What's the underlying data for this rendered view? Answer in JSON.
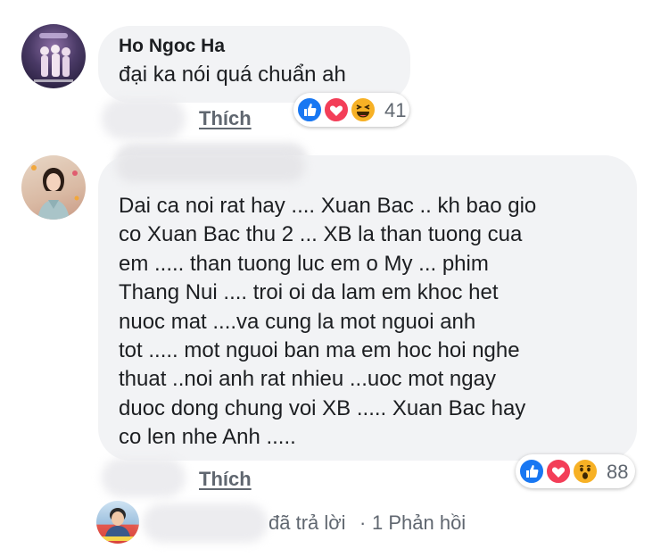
{
  "comments": [
    {
      "author": "Ho Ngoc Ha",
      "text": "đại ka nói quá chuẩn ah",
      "like_label": "Thích",
      "reactions": [
        "like-icon",
        "love-icon",
        "haha-icon"
      ],
      "reaction_count": "41"
    },
    {
      "author": "",
      "text": "Dai ca noi rat hay .... Xuan Bac .. kh bao gio\nco Xuan Bac thu 2 ... XB la than tuong cua\nem .....  than tuong luc em o My ... phim\nThang Nui .... troi oi da lam em khoc het\nnuoc mat ....va cung la mot nguoi anh\ntot ..... mot nguoi ban ma em hoc hoi nghe\nthuat ..noi anh rat nhieu ...uoc mot ngay\nduoc dong chung voi XB ..... Xuan Bac hay\nco len nhe Anh .....",
      "like_label": "Thích",
      "reactions": [
        "like-icon",
        "love-icon",
        "wow-icon"
      ],
      "reaction_count": "88"
    }
  ],
  "reply_summary": {
    "text": "đã trả lời",
    "separator": "·",
    "count_text": "1 Phản hồi"
  },
  "colors": {
    "bubble": "#f2f3f5",
    "like": "#1877f2",
    "love": "#f33e58",
    "haha": "#f7b125",
    "meta": "#606770"
  }
}
